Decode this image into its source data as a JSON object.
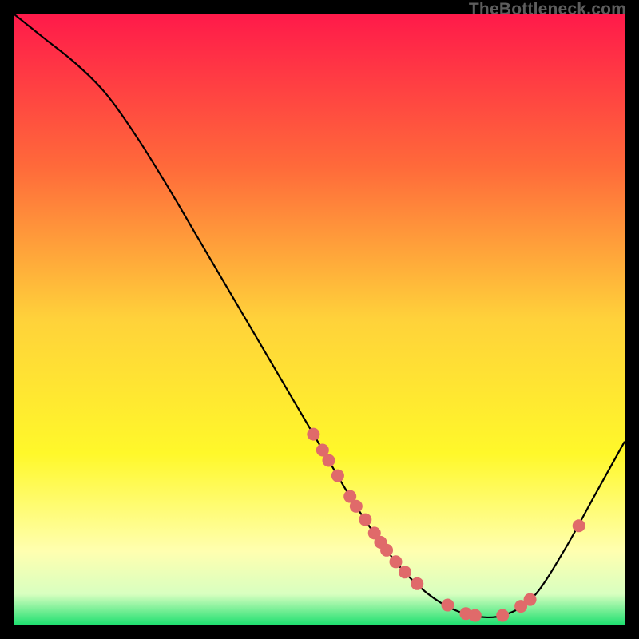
{
  "watermark": "TheBottleneck.com",
  "chart_data": {
    "type": "line",
    "title": "",
    "xlabel": "",
    "ylabel": "",
    "xlim": [
      0,
      100
    ],
    "ylim": [
      0,
      100
    ],
    "curve": [
      {
        "x": 0,
        "y": 100
      },
      {
        "x": 5,
        "y": 96
      },
      {
        "x": 10,
        "y": 92
      },
      {
        "x": 15,
        "y": 87
      },
      {
        "x": 20,
        "y": 80
      },
      {
        "x": 25,
        "y": 72
      },
      {
        "x": 30,
        "y": 63.5
      },
      {
        "x": 35,
        "y": 55
      },
      {
        "x": 40,
        "y": 46.5
      },
      {
        "x": 45,
        "y": 38
      },
      {
        "x": 50,
        "y": 29.5
      },
      {
        "x": 55,
        "y": 21
      },
      {
        "x": 60,
        "y": 13.5
      },
      {
        "x": 65,
        "y": 7.5
      },
      {
        "x": 70,
        "y": 3.5
      },
      {
        "x": 75,
        "y": 1.5
      },
      {
        "x": 80,
        "y": 1.5
      },
      {
        "x": 85,
        "y": 4.5
      },
      {
        "x": 90,
        "y": 12
      },
      {
        "x": 95,
        "y": 21
      },
      {
        "x": 100,
        "y": 30
      }
    ],
    "dots": [
      {
        "x": 49,
        "y": 31.2
      },
      {
        "x": 50.5,
        "y": 28.6
      },
      {
        "x": 51.5,
        "y": 26.9
      },
      {
        "x": 53,
        "y": 24.4
      },
      {
        "x": 55,
        "y": 21
      },
      {
        "x": 56,
        "y": 19.4
      },
      {
        "x": 57.5,
        "y": 17.2
      },
      {
        "x": 59,
        "y": 15
      },
      {
        "x": 60,
        "y": 13.5
      },
      {
        "x": 61,
        "y": 12.2
      },
      {
        "x": 62.5,
        "y": 10.3
      },
      {
        "x": 64,
        "y": 8.6
      },
      {
        "x": 66,
        "y": 6.7
      },
      {
        "x": 71,
        "y": 3.2
      },
      {
        "x": 74,
        "y": 1.8
      },
      {
        "x": 75.5,
        "y": 1.5
      },
      {
        "x": 80,
        "y": 1.5
      },
      {
        "x": 83,
        "y": 3.0
      },
      {
        "x": 84.5,
        "y": 4.1
      },
      {
        "x": 92.5,
        "y": 16.2
      }
    ],
    "gradient_stops": [
      {
        "offset": 0,
        "color": "#ff1a4a"
      },
      {
        "offset": 0.25,
        "color": "#ff6a3a"
      },
      {
        "offset": 0.5,
        "color": "#ffd23a"
      },
      {
        "offset": 0.72,
        "color": "#fff82a"
      },
      {
        "offset": 0.88,
        "color": "#ffffb0"
      },
      {
        "offset": 0.95,
        "color": "#d8ffc0"
      },
      {
        "offset": 1.0,
        "color": "#20e070"
      }
    ],
    "dot_color": "#e06a6a",
    "curve_color": "#000000"
  }
}
